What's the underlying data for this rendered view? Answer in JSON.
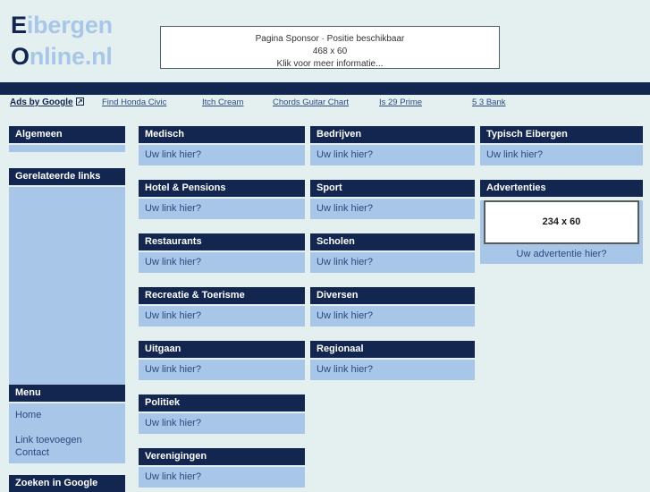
{
  "site": {
    "logo_line1_cap": "E",
    "logo_line1_rest": "ibergen",
    "logo_line2_cap": "O",
    "logo_line2_rest": "nline.nl"
  },
  "sponsor": {
    "line1": "Pagina Sponsor · Positie beschikbaar",
    "line2": "468 x 60",
    "line3": "Klik voor meer informatie..."
  },
  "ads": {
    "label": "Ads by Google",
    "icon": "external-link-icon",
    "links": [
      "Find Honda Civic",
      "Itch Cream",
      "Chords Guitar Chart",
      "Is 29 Prime",
      "5 3 Bank"
    ]
  },
  "sidebar": {
    "panels": [
      {
        "title": "Algemeen",
        "rows": []
      },
      {
        "title": "Gerelateerde links",
        "rows": []
      },
      {
        "title": "Menu",
        "rows": [
          "Home",
          "",
          "Link toevoegen",
          "Contact"
        ]
      },
      {
        "title": "Zoeken in Google",
        "rows": []
      }
    ]
  },
  "main": {
    "placeholder": "Uw link hier?",
    "column1": [
      "Medisch",
      "Hotel & Pensions",
      "Restaurants",
      "Recreatie & Toerisme",
      "Uitgaan",
      "Politiek",
      "Verenigingen"
    ],
    "column2": [
      "Bedrijven",
      "Sport",
      "Scholen",
      "Diversen",
      "Regionaal"
    ]
  },
  "right": {
    "typisch_title": "Typisch Eibergen",
    "typisch_link": "Uw link hier?",
    "adverts_title": "Advertenties",
    "ad_size": "234 x 60",
    "ad_caption": "Uw advertentie hier?"
  },
  "colors": {
    "page_bg": "#e4f0f0",
    "header_dark": "#12264f",
    "panel_body": "#a8c6e8",
    "link": "#2a4a80",
    "logo_light": "#a8c6e8"
  }
}
